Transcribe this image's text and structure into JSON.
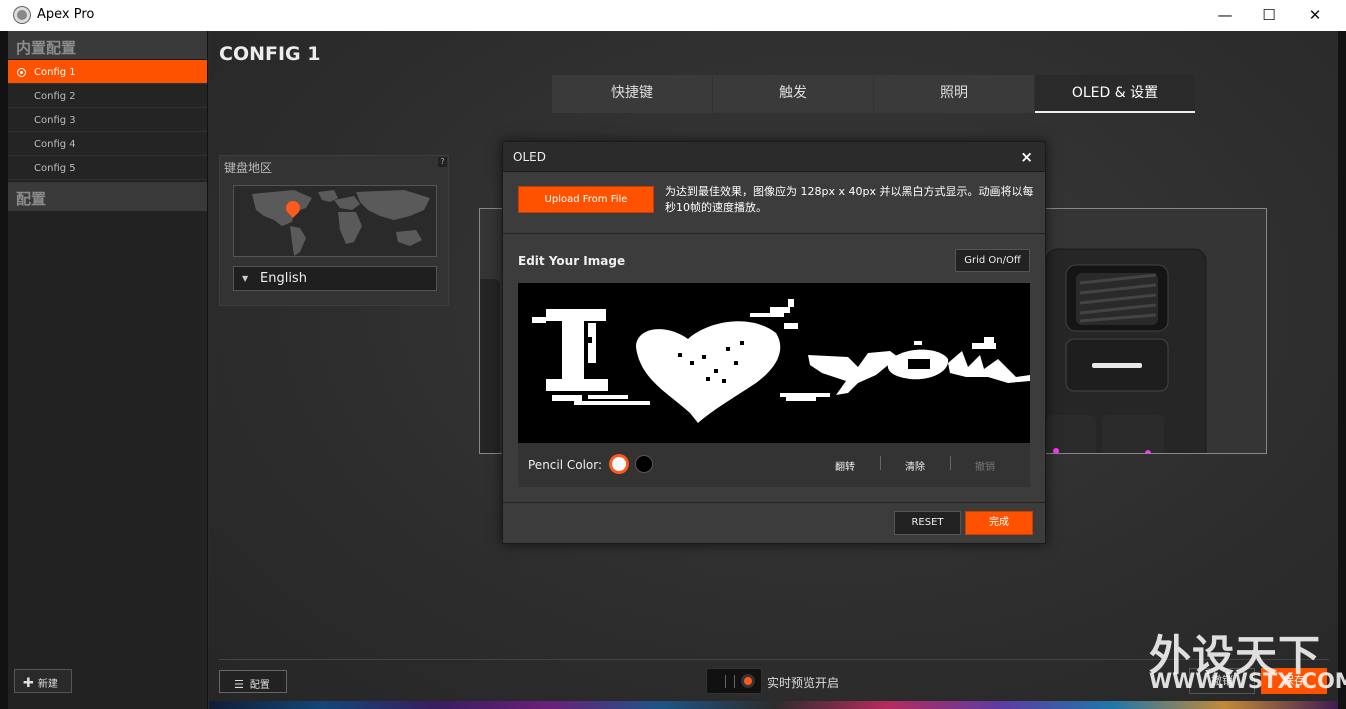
{
  "window": {
    "title": "Apex Pro",
    "minimize": "—",
    "maximize": "☐",
    "close": "✕"
  },
  "sidebar": {
    "section_builtin": "内置配置",
    "items": [
      {
        "label": "Config 1",
        "active": true
      },
      {
        "label": "Config 2"
      },
      {
        "label": "Config 3"
      },
      {
        "label": "Config 4"
      },
      {
        "label": "Config 5"
      }
    ],
    "section_configs": "配置",
    "new_button": "新建"
  },
  "main": {
    "config_title": "CONFIG 1",
    "tabs": [
      {
        "label": "快捷键"
      },
      {
        "label": "触发"
      },
      {
        "label": "照明"
      },
      {
        "label": "OLED & 设置",
        "active": true
      }
    ],
    "region": {
      "label": "键盘地区",
      "help": "?",
      "language": "English"
    },
    "bottom": {
      "config_button": "配置",
      "preview_label": "实时预览开启",
      "revert_button": "撤销",
      "save_button": "保存"
    },
    "watermark": "外设天下",
    "watermark_sub": "WWW.WSTX.COM"
  },
  "modal": {
    "title": "OLED",
    "close": "×",
    "upload_button": "Upload From File",
    "upload_note": "为达到最佳效果，图像应为 128px x 40px 并以黑白方式显示。动画将以每秒10帧的速度播放。",
    "edit_title": "Edit Your Image",
    "grid_button": "Grid On/Off",
    "pencil_label": "Pencil Color:",
    "tools": [
      "翻转",
      "清除",
      "撤销"
    ],
    "reset_button": "RESET",
    "done_button": "完成"
  },
  "colors": {
    "accent": "#ff5200",
    "background": "#2e2e2e"
  }
}
